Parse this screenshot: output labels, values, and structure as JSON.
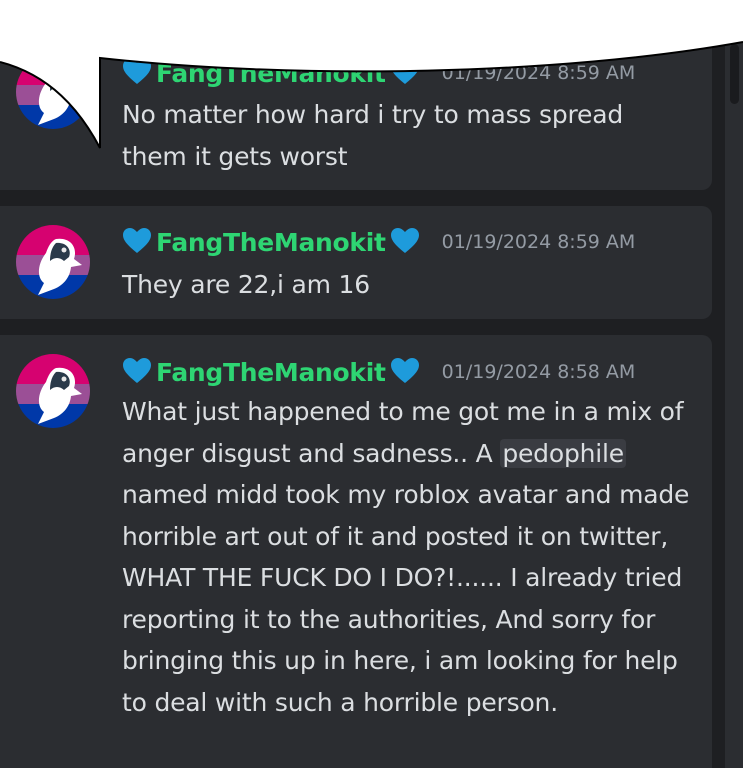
{
  "messages": [
    {
      "username": "FangTheManokit",
      "timestamp": "01/19/2024 8:59 AM",
      "text": "No matter how hard i try to mass spread them it gets worst"
    },
    {
      "username": "FangTheManokit",
      "timestamp": "01/19/2024 8:59 AM",
      "text": "They are 22,i am 16"
    },
    {
      "username": "FangTheManokit",
      "timestamp": "01/19/2024 8:58 AM",
      "text_before": "What just happened to me got me in a mix of anger disgust and sadness.. A ",
      "highlighted_word": "pedophile",
      "text_after": " named midd took my roblox avatar and made horrible art out of it and posted it on twitter, WHAT THE FUCK DO I DO?!...... I already tried reporting it to the authorities, And sorry for bringing this up in here, i am looking for help to deal with such a horrible person."
    }
  ],
  "colors": {
    "username": "#2ed573",
    "heart": "#1e9bdb",
    "message_bg": "#2b2d31",
    "app_bg": "#1e1f22",
    "text": "#dbdee1",
    "timestamp": "#949ba4"
  },
  "icons": {
    "decoration": "blue-heart-icon",
    "avatar": "bi-flag-penguin-avatar"
  }
}
